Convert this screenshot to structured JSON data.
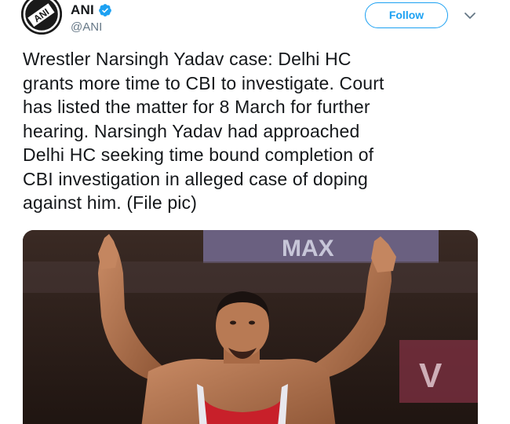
{
  "account": {
    "display_name": "ANI",
    "handle": "@ANI",
    "avatar_text": "ANI",
    "verified": true
  },
  "actions": {
    "follow_label": "Follow"
  },
  "tweet": {
    "lines": [
      "Wrestler Narsingh Yadav case: Delhi HC",
      "grants more time to CBI to investigate. Court",
      "has listed the matter for 8 March for further",
      "hearing. Narsingh Yadav had approached",
      "Delhi HC seeking time bound completion of",
      "CBI investigation in alleged case of doping",
      "against him. (File pic)"
    ]
  },
  "media": {
    "banner_text": "MAX",
    "side_text": "V"
  },
  "colors": {
    "accent": "#1da1f2",
    "text": "#14171a",
    "secondary": "#657786"
  }
}
